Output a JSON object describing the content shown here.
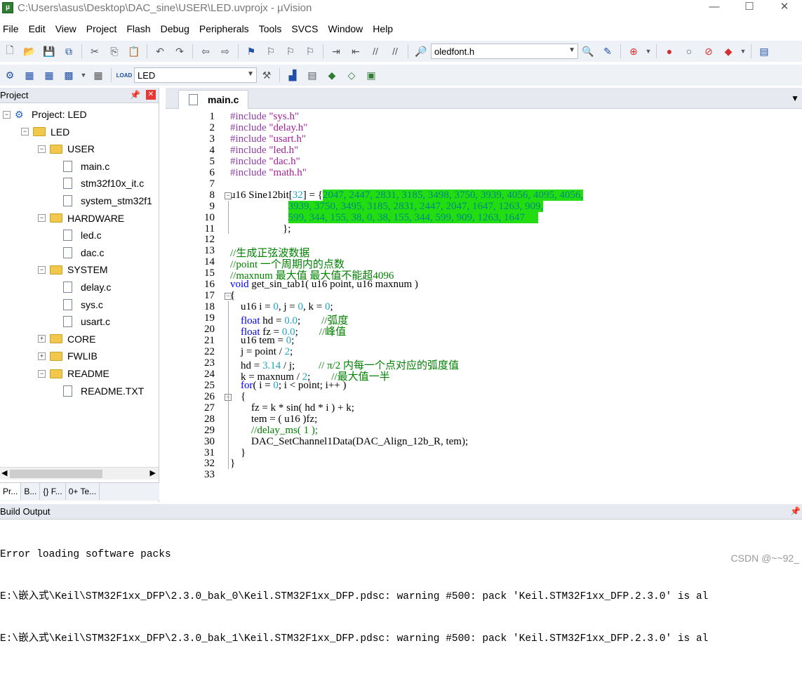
{
  "window": {
    "title": "C:\\Users\\asus\\Desktop\\DAC_sine\\USER\\LED.uvprojx - µVision",
    "app_icon": "uvision-icon",
    "controls": [
      "—",
      "☐",
      "✕"
    ]
  },
  "menu": [
    "File",
    "Edit",
    "View",
    "Project",
    "Flash",
    "Debug",
    "Peripherals",
    "Tools",
    "SVCS",
    "Window",
    "Help"
  ],
  "toolbar1": {
    "find_value": "oledfont.h"
  },
  "toolbar2": {
    "target_value": "LED",
    "load_label": "LOAD"
  },
  "project_pane": {
    "title": "Project",
    "tree": [
      {
        "label": "Project: LED",
        "kind": "project",
        "level": 0,
        "expander": "−"
      },
      {
        "label": "LED",
        "kind": "folder",
        "level": 1,
        "expander": "−"
      },
      {
        "label": "USER",
        "kind": "folder",
        "level": 2,
        "expander": "−"
      },
      {
        "label": "main.c",
        "kind": "file",
        "level": 3
      },
      {
        "label": "stm32f10x_it.c",
        "kind": "file",
        "level": 3
      },
      {
        "label": "system_stm32f1",
        "kind": "file",
        "level": 3
      },
      {
        "label": "HARDWARE",
        "kind": "folder",
        "level": 2,
        "expander": "−"
      },
      {
        "label": "led.c",
        "kind": "file",
        "level": 3
      },
      {
        "label": "dac.c",
        "kind": "file",
        "level": 3
      },
      {
        "label": "SYSTEM",
        "kind": "folder",
        "level": 2,
        "expander": "−"
      },
      {
        "label": "delay.c",
        "kind": "file",
        "level": 3
      },
      {
        "label": "sys.c",
        "kind": "file",
        "level": 3
      },
      {
        "label": "usart.c",
        "kind": "file",
        "level": 3
      },
      {
        "label": "CORE",
        "kind": "folder",
        "level": 2,
        "expander": "+"
      },
      {
        "label": "FWLIB",
        "kind": "folder",
        "level": 2,
        "expander": "+"
      },
      {
        "label": "README",
        "kind": "folder",
        "level": 2,
        "expander": "−"
      },
      {
        "label": "README.TXT",
        "kind": "file",
        "level": 3
      }
    ],
    "tabs": [
      "Pr...",
      "B...",
      "{} F...",
      "0+ Te..."
    ]
  },
  "editor": {
    "tab": "main.c",
    "lines": [
      {
        "n": "1",
        "code": "#include \"sys.h\""
      },
      {
        "n": "2",
        "code": "#include \"delay.h\""
      },
      {
        "n": "3",
        "code": "#include \"usart.h\""
      },
      {
        "n": "4",
        "code": "#include \"led.h\""
      },
      {
        "n": "5",
        "code": "#include \"dac.h\""
      },
      {
        "n": "6",
        "code": "#include \"math.h\""
      },
      {
        "n": "7",
        "code": ""
      },
      {
        "n": "8",
        "code": "u16 Sine12bit[32] = {2047, 2447, 2831, 3185, 3498, 3750, 3939, 4056, 4095, 4056,"
      },
      {
        "n": "9",
        "code": "                      3939, 3750, 3495, 3185, 2831, 2447, 2047, 1647, 1263, 909,"
      },
      {
        "n": "10",
        "code": "                      599, 344, 155, 38, 0, 38, 155, 344, 599, 909, 1263, 1647"
      },
      {
        "n": "11",
        "code": "                    };"
      },
      {
        "n": "12",
        "code": ""
      },
      {
        "n": "13",
        "code": "//生成正弦波数据"
      },
      {
        "n": "14",
        "code": "//point 一个周期内的点数"
      },
      {
        "n": "15",
        "code": "//maxnum 最大值 最大值不能超4096"
      },
      {
        "n": "16",
        "code": "void get_sin_tab1( u16 point, u16 maxnum )"
      },
      {
        "n": "17",
        "code": "{"
      },
      {
        "n": "18",
        "code": "    u16 i = 0, j = 0, k = 0;"
      },
      {
        "n": "19",
        "code": "    float hd = 0.0;        //弧度"
      },
      {
        "n": "20",
        "code": "    float fz = 0.0;        //峰值"
      },
      {
        "n": "21",
        "code": "    u16 tem = 0;"
      },
      {
        "n": "22",
        "code": "    j = point / 2;"
      },
      {
        "n": "23",
        "code": "    hd = 3.14 / j;         // π/2 内每一个点对应的弧度值"
      },
      {
        "n": "24",
        "code": "    k = maxnum / 2;        //最大值一半"
      },
      {
        "n": "25",
        "code": "    for( i = 0; i < point; i++ )"
      },
      {
        "n": "26",
        "code": "    {"
      },
      {
        "n": "27",
        "code": "        fz = k * sin( hd * i ) + k;"
      },
      {
        "n": "28",
        "code": "        tem = ( u16 )fz;"
      },
      {
        "n": "29",
        "code": "        //delay_ms( 1 );"
      },
      {
        "n": "30",
        "code": "        DAC_SetChannel1Data(DAC_Align_12b_R, tem);"
      },
      {
        "n": "31",
        "code": "    }"
      },
      {
        "n": "32",
        "code": "}"
      },
      {
        "n": "33",
        "code": ""
      }
    ]
  },
  "build_output": {
    "title": "Build Output",
    "lines": [
      "Error loading software packs",
      "E:\\嵌入式\\Keil\\STM32F1xx_DFP\\2.3.0_bak_0\\Keil.STM32F1xx_DFP.pdsc: warning #500: pack 'Keil.STM32F1xx_DFP.2.3.0' is al",
      "E:\\嵌入式\\Keil\\STM32F1xx_DFP\\2.3.0_bak_1\\Keil.STM32F1xx_DFP.pdsc: warning #500: pack 'Keil.STM32F1xx_DFP.2.3.0' is al"
    ],
    "watermark": "CSDN @~~92_"
  }
}
